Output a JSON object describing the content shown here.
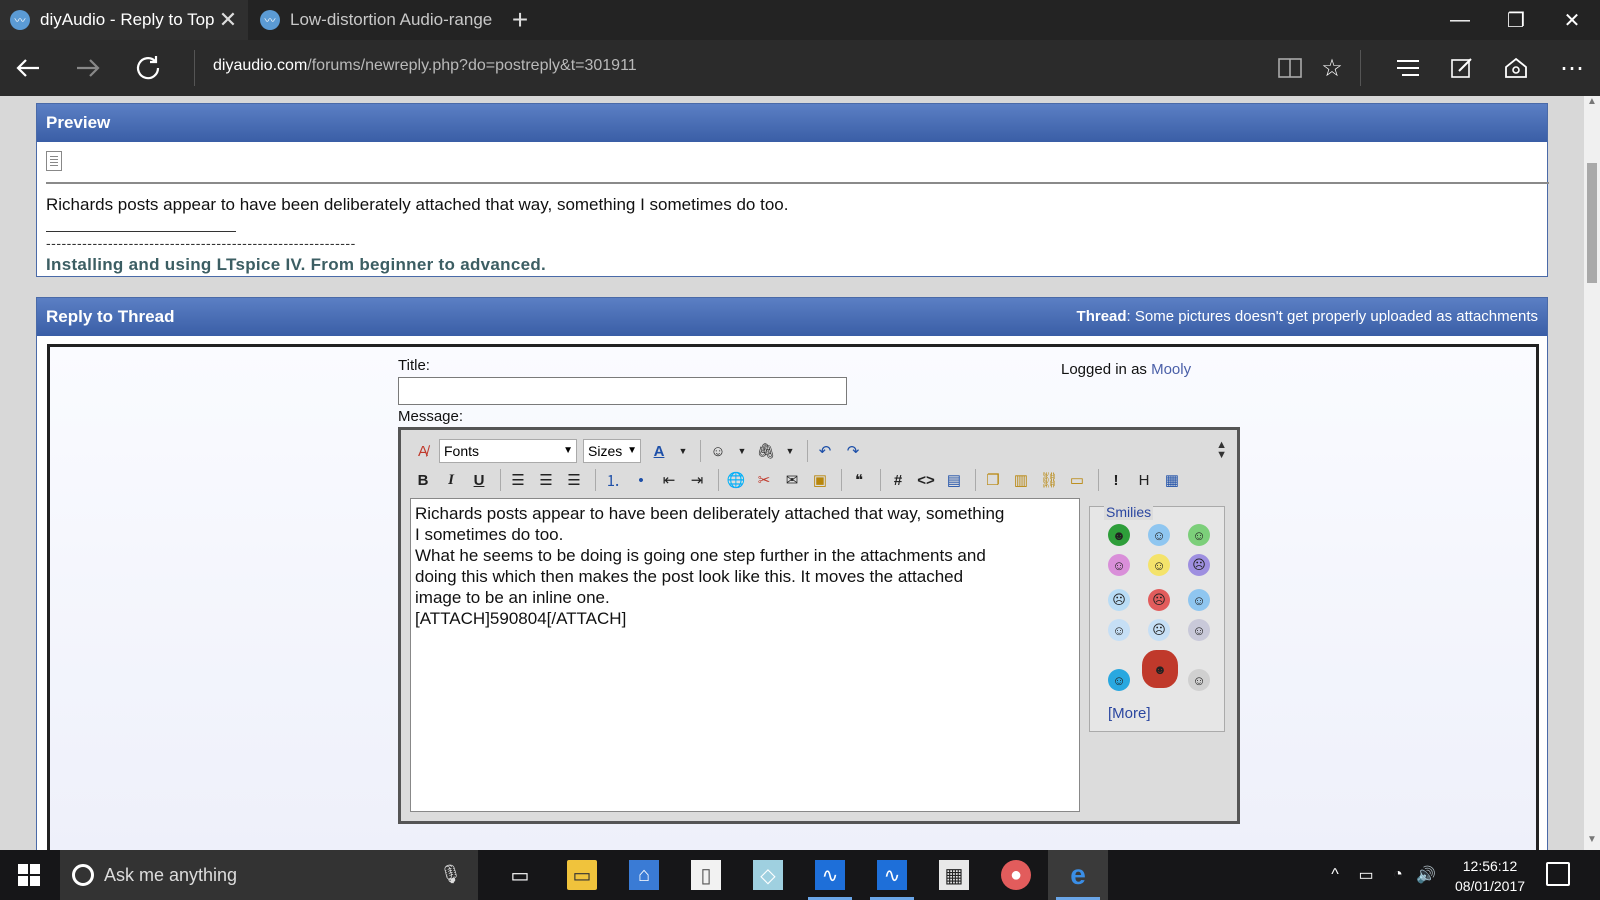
{
  "browser": {
    "tabs": [
      {
        "label": "diyAudio - Reply to Top",
        "active": true
      },
      {
        "label": "Low-distortion Audio-range",
        "active": false
      }
    ],
    "new_tab": "+",
    "window_controls": {
      "minimize": "—",
      "restore": "❐",
      "close": "✕"
    },
    "url_host": "diyaudio.com",
    "url_path": "/forums/newreply.php?do=postreply&t=301911"
  },
  "preview": {
    "heading": "Preview",
    "text": "Richards posts appear to have been deliberately attached that way, something I sometimes do too.",
    "signature_dashes": "------------------------------------------------------------",
    "signature_link": "Installing and using LTspice IV. From beginner to advanced."
  },
  "reply": {
    "heading": "Reply to Thread",
    "thread_label": "Thread",
    "thread_title": ": Some pictures doesn't get properly uploaded as attachments",
    "title_label": "Title:",
    "title_value": "",
    "message_label": "Message:",
    "logged_in_prefix": "Logged in as ",
    "logged_in_user": "Mooly",
    "fonts_dropdown": "Fonts",
    "sizes_dropdown": "Sizes",
    "message_lines": [
      "Richards posts appear to have been deliberately attached that way, something",
      "I sometimes do too.",
      "",
      "What he seems to be doing is going one step further in the attachments and",
      "doing this which then makes the post look like this. It moves the attached",
      "image to be an inline one.",
      "",
      "[ATTACH]590804[/ATTACH]"
    ],
    "smilies_legend": "Smilies",
    "smilies_more": "[More]"
  },
  "taskbar": {
    "search_placeholder": "Ask me anything",
    "time": "12:56:12",
    "date": "08/01/2017"
  },
  "colors": {
    "panel_header": "#3a5ea6",
    "link": "#2a46a0",
    "signature": "#3c5e63"
  }
}
